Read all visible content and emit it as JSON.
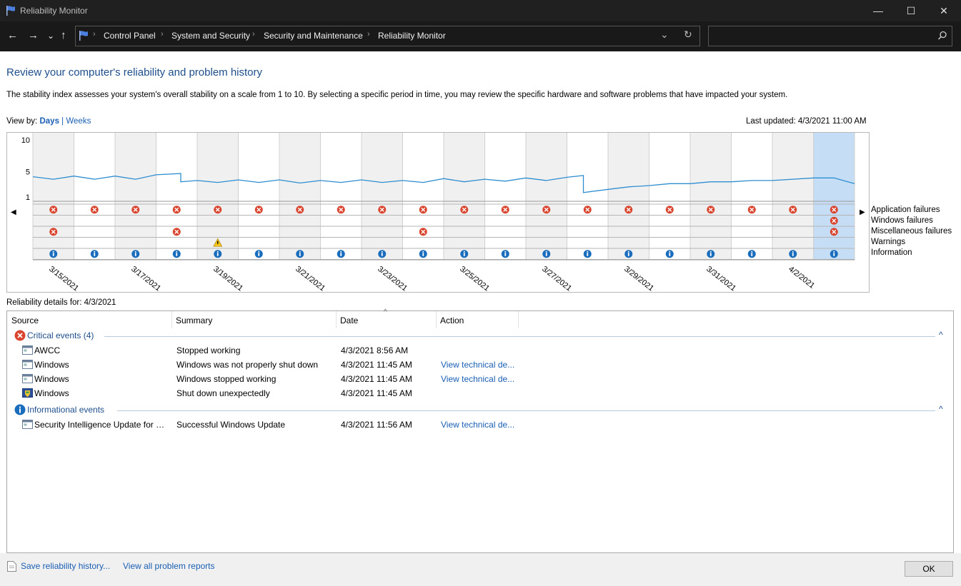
{
  "window": {
    "title": "Reliability Monitor",
    "minimize": "—",
    "maximize": "☐",
    "close": "✕"
  },
  "nav": {
    "back": "←",
    "forward": "→",
    "recent": "⌄",
    "up": "↑",
    "breadcrumbs": [
      "Control Panel",
      "System and Security",
      "Security and Maintenance",
      "Reliability Monitor"
    ],
    "dropdown": "⌄",
    "refresh": "↻",
    "search_placeholder": "",
    "search_icon": "search-icon"
  },
  "heading": "Review your computer's reliability and problem history",
  "description": "The stability index assesses your system's overall stability on a scale from 1 to 10. By selecting a specific period in time, you may review the specific hardware and software problems that have impacted your system.",
  "view_by": {
    "label": "View by:",
    "days": "Days",
    "separator": "|",
    "weeks": "Weeks",
    "selected": "Days"
  },
  "last_updated": "Last updated: 4/3/2021 11:00 AM",
  "chart_data": {
    "type": "line",
    "y_ticks": [
      "10",
      "5",
      "1"
    ],
    "ylim": [
      1,
      10
    ],
    "x_labels": [
      "3/15/2021",
      "3/17/2021",
      "3/19/2021",
      "3/21/2021",
      "3/23/2021",
      "3/25/2021",
      "3/27/2021",
      "3/29/2021",
      "3/31/2021",
      "4/2/2021"
    ],
    "days": 20,
    "selected_day": 19,
    "stability_points": [
      [
        0.0,
        4.2
      ],
      [
        0.5,
        3.8
      ],
      [
        1.0,
        4.3
      ],
      [
        1.0,
        4.3
      ],
      [
        1.5,
        3.8
      ],
      [
        2.0,
        4.3
      ],
      [
        2.0,
        4.3
      ],
      [
        2.5,
        3.8
      ],
      [
        3.0,
        4.5
      ],
      [
        3.0,
        4.5
      ],
      [
        3.6,
        4.7
      ],
      [
        3.6,
        3.4
      ],
      [
        4.0,
        3.6
      ],
      [
        4.0,
        3.6
      ],
      [
        4.5,
        3.3
      ],
      [
        5.0,
        3.7
      ],
      [
        5.0,
        3.7
      ],
      [
        5.5,
        3.3
      ],
      [
        6.0,
        3.7
      ],
      [
        6.0,
        3.7
      ],
      [
        6.5,
        3.2
      ],
      [
        7.0,
        3.6
      ],
      [
        7.0,
        3.6
      ],
      [
        7.5,
        3.3
      ],
      [
        8.0,
        3.7
      ],
      [
        8.0,
        3.7
      ],
      [
        8.5,
        3.3
      ],
      [
        9.0,
        3.6
      ],
      [
        9.0,
        3.6
      ],
      [
        9.5,
        3.3
      ],
      [
        10.0,
        3.9
      ],
      [
        10.0,
        3.9
      ],
      [
        10.5,
        3.4
      ],
      [
        11.0,
        3.8
      ],
      [
        11.0,
        3.8
      ],
      [
        11.5,
        3.5
      ],
      [
        12.0,
        4.0
      ],
      [
        12.0,
        4.0
      ],
      [
        12.5,
        3.6
      ],
      [
        13.0,
        4.1
      ],
      [
        13.0,
        4.1
      ],
      [
        13.4,
        4.4
      ],
      [
        13.4,
        1.7
      ],
      [
        14.0,
        2.2
      ],
      [
        14.0,
        2.2
      ],
      [
        14.5,
        2.6
      ],
      [
        15.0,
        2.8
      ],
      [
        15.0,
        2.8
      ],
      [
        15.5,
        3.1
      ],
      [
        16.0,
        3.1
      ],
      [
        16.0,
        3.1
      ],
      [
        16.5,
        3.4
      ],
      [
        17.0,
        3.4
      ],
      [
        17.0,
        3.4
      ],
      [
        17.5,
        3.6
      ],
      [
        18.0,
        3.6
      ],
      [
        18.0,
        3.6
      ],
      [
        19.0,
        4.0
      ],
      [
        19.5,
        4.0
      ],
      [
        20.0,
        3.1
      ]
    ],
    "rows": [
      {
        "legend": "Application failures",
        "kind": "error",
        "days": [
          0,
          1,
          2,
          3,
          4,
          5,
          6,
          7,
          8,
          9,
          10,
          11,
          12,
          13,
          14,
          15,
          16,
          17,
          18,
          19
        ]
      },
      {
        "legend": "Windows failures",
        "kind": "error",
        "days": [
          19
        ]
      },
      {
        "legend": "Miscellaneous failures",
        "kind": "error",
        "days": [
          0,
          3,
          9,
          19
        ]
      },
      {
        "legend": "Warnings",
        "kind": "warning",
        "days": [
          4
        ]
      },
      {
        "legend": "Information",
        "kind": "info",
        "days": [
          0,
          1,
          2,
          3,
          4,
          5,
          6,
          7,
          8,
          9,
          10,
          11,
          12,
          13,
          14,
          15,
          16,
          17,
          18,
          19
        ]
      }
    ],
    "colors": {
      "line": "#2f8ed0",
      "selected": "#c5def5",
      "shaded": "#f0f0f0",
      "error": "#d9452f",
      "info": "#1a6dbd",
      "warning": "#f4c41e"
    }
  },
  "details": {
    "label": "Reliability details for: 4/3/2021",
    "columns": [
      "Source",
      "Summary",
      "Date",
      "Action"
    ],
    "sort_indicator": "^",
    "groups": [
      {
        "title": "Critical events (4)",
        "icon": "error-icon",
        "collapse": "^",
        "rows": [
          {
            "source": "AWCC",
            "summary": "Stopped working",
            "date": "4/3/2021 8:56 AM",
            "action": "",
            "icon": "app-window-icon"
          },
          {
            "source": "Windows",
            "summary": "Windows was not properly shut down",
            "date": "4/3/2021 11:45 AM",
            "action": "View technical de...",
            "icon": "app-window-icon"
          },
          {
            "source": "Windows",
            "summary": "Windows stopped working",
            "date": "4/3/2021 11:45 AM",
            "action": "View technical de...",
            "icon": "app-window-icon"
          },
          {
            "source": "Windows",
            "summary": "Shut down unexpectedly",
            "date": "4/3/2021 11:45 AM",
            "action": "",
            "icon": "shield-window-icon"
          }
        ]
      },
      {
        "title": "Informational events",
        "icon": "info-icon",
        "collapse": "^",
        "rows": [
          {
            "source": "Security Intelligence Update for M...",
            "summary": "Successful Windows Update",
            "date": "4/3/2021 11:56 AM",
            "action": "View technical de...",
            "icon": "app-window-icon"
          }
        ]
      }
    ]
  },
  "footer": {
    "save": "Save reliability history...",
    "view_all": "View all problem reports",
    "ok": "OK"
  }
}
